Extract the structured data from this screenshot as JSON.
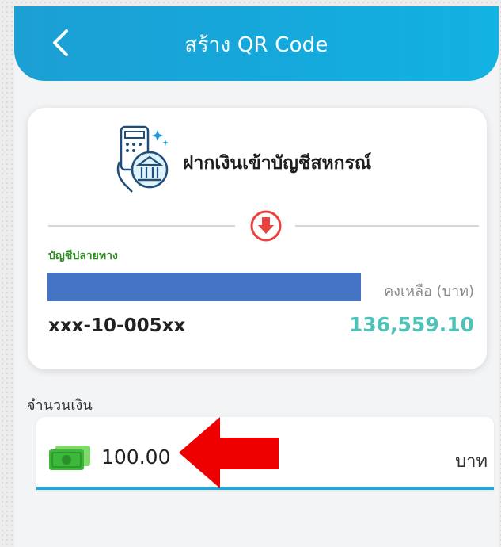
{
  "header": {
    "title": "สร้าง QR Code",
    "back_icon": "chevron-left-icon"
  },
  "card": {
    "service_icon": "bank-app-icon",
    "service_title": "ฝากเงินเข้าบัญชีสหกรณ์",
    "direction_icon": "arrow-down-circle-icon",
    "destination_label": "บัญชีปลายทาง",
    "balance_label": "คงเหลือ (บาท)",
    "account_number": "xxx-10-005xx",
    "balance_value": "136,559.10"
  },
  "amount": {
    "label": "จำนวนเงิน",
    "icon": "cash-icon",
    "value": "100.00",
    "unit": "บาท"
  },
  "annotation": {
    "arrow_icon": "red-arrow-left-icon"
  },
  "colors": {
    "header": "#1c9fd4",
    "accent_green": "#2e8a22",
    "balance": "#4fc2b8",
    "redaction": "#4472c4",
    "arrow": "#ee0000",
    "field_underline": "#1ea6d9"
  }
}
